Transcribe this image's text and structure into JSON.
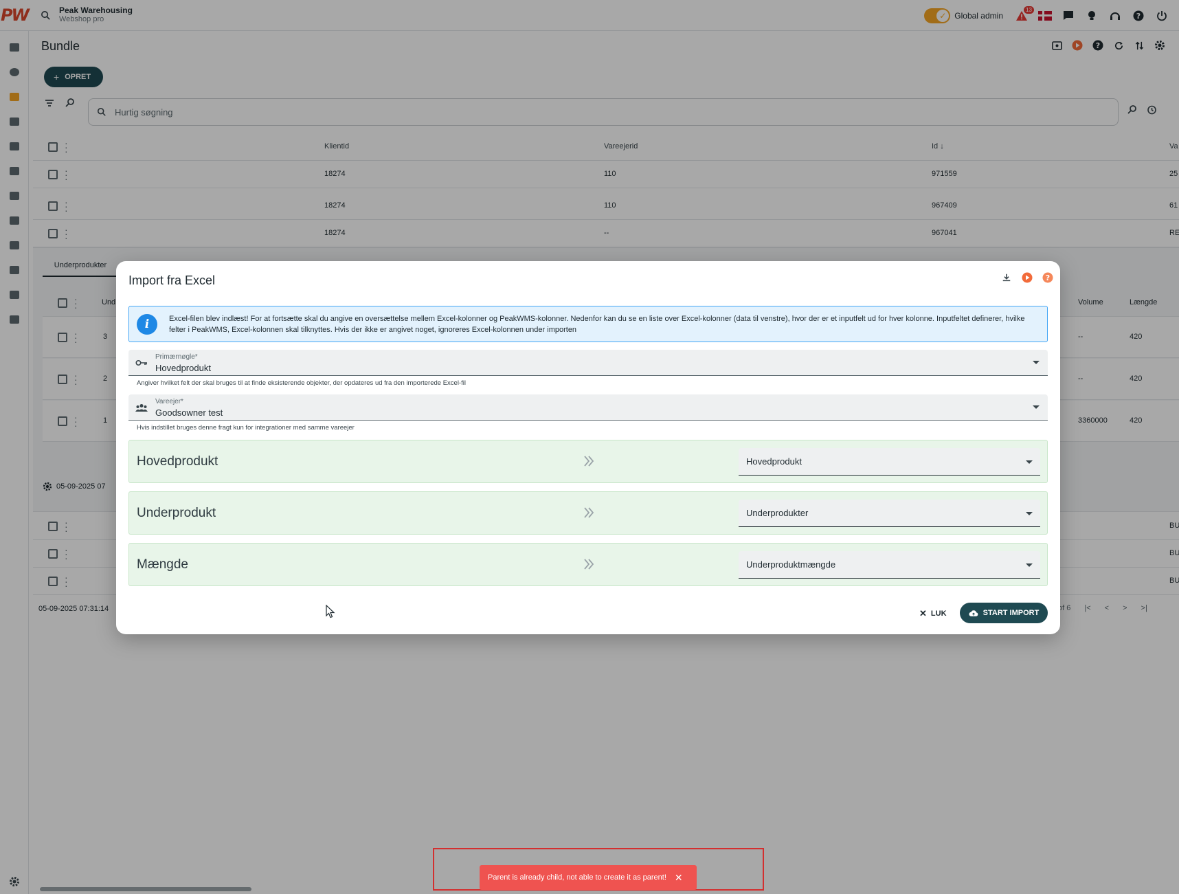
{
  "header": {
    "logo": "PW",
    "company": "Peak Warehousing",
    "product": "Webshop pro",
    "role": "Global admin",
    "notification_count": "13"
  },
  "page": {
    "title": "Bundle",
    "create_label": "OPRET",
    "search_placeholder": "Hurtig søgning"
  },
  "grid": {
    "columns": [
      "Klientid",
      "Vareejerid",
      "Id",
      "Va"
    ],
    "rows": [
      {
        "client": "18274",
        "owner": "110",
        "id": "971559",
        "extra": "25"
      },
      {
        "client": "18274",
        "owner": "110",
        "id": "967409",
        "extra": "61"
      },
      {
        "client": "18274",
        "owner": "--",
        "id": "967041",
        "extra": "RE"
      }
    ],
    "lower_rows_extra": [
      "BU",
      "BU",
      "BU"
    ],
    "footer_timestamp": "05-09-2025 07:31:14",
    "pager_text": "of 6"
  },
  "detail": {
    "tab_label": "Underprodukter",
    "col_first": "Und",
    "col_volume": "Volume",
    "col_length": "Længde",
    "rows": [
      {
        "n": "3",
        "volume": "--",
        "length": "420"
      },
      {
        "n": "2",
        "volume": "--",
        "length": "420"
      },
      {
        "n": "1",
        "volume": "3360000",
        "length": "420"
      }
    ],
    "footer_timestamp": "05-09-2025 07"
  },
  "dialog": {
    "title": "Import fra Excel",
    "info_text": "Excel-filen blev indlæst! For at fortsætte skal du angive en oversættelse mellem Excel-kolonner og PeakWMS-kolonner. Nedenfor kan du se en liste over Excel-kolonner (data til venstre), hvor der er et inputfelt ud for hver kolonne. Inputfeltet definerer, hvilke felter i PeakWMS, Excel-kolonnen skal tilknyttes. Hvis der ikke er angivet noget, ignoreres Excel-kolonnen under importen",
    "primary_key": {
      "label": "Primærnøgle*",
      "value": "Hovedprodukt",
      "hint": "Angiver hvilket felt der skal bruges til at finde eksisterende objekter, der opdateres ud fra den importerede Excel-fil"
    },
    "owner": {
      "label": "Vareejer*",
      "value": "Goodsowner test",
      "hint": "Hvis indstillet bruges denne fragt kun for integrationer med samme vareejer"
    },
    "mappings": [
      {
        "excel_column": "Hovedprodukt",
        "target": "Hovedprodukt"
      },
      {
        "excel_column": "Underprodukt",
        "target": "Underprodukter"
      },
      {
        "excel_column": "Mængde",
        "target": "Underproduktmængde"
      }
    ],
    "close_label": "LUK",
    "start_label": "START IMPORT"
  },
  "snackbar": {
    "message": "Parent is already child, not able to create it as parent!"
  }
}
